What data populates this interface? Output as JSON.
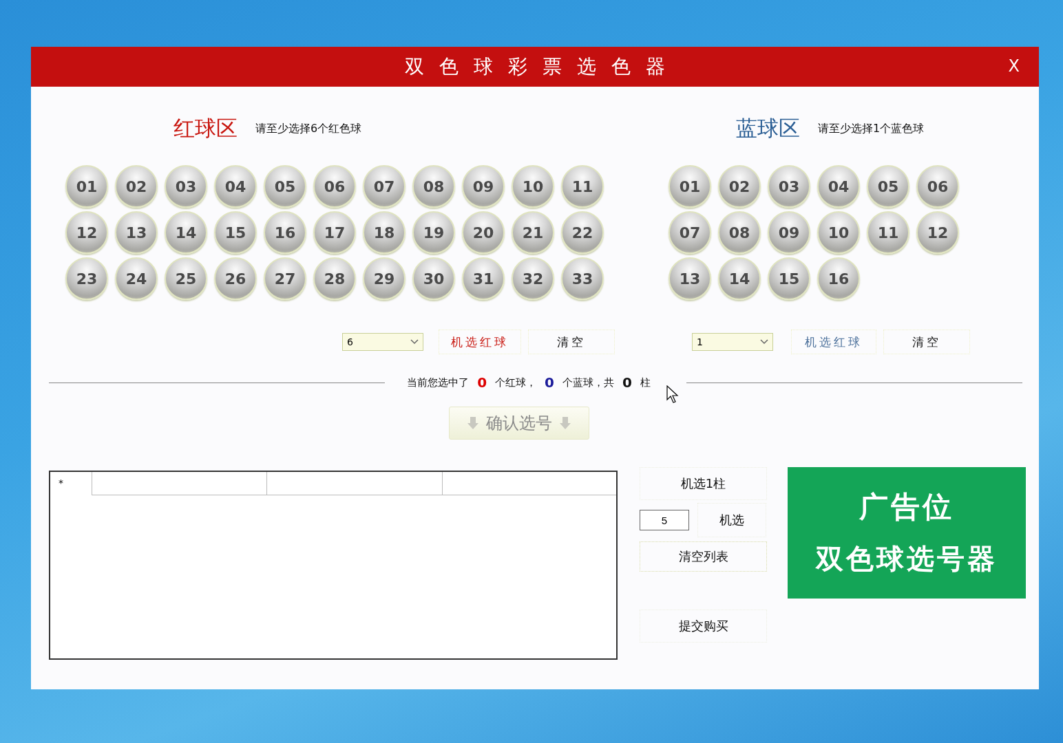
{
  "window": {
    "title": "双色球彩票选色器",
    "close": "X"
  },
  "red_zone": {
    "title": "红球区",
    "hint": "请至少选择6个红色球",
    "balls": [
      {
        "number": "01",
        "selected": false
      },
      {
        "number": "02",
        "selected": false
      },
      {
        "number": "03",
        "selected": false
      },
      {
        "number": "04",
        "selected": false
      },
      {
        "number": "05",
        "selected": false
      },
      {
        "number": "06",
        "selected": false
      },
      {
        "number": "07",
        "selected": false
      },
      {
        "number": "08",
        "selected": false
      },
      {
        "number": "09",
        "selected": false
      },
      {
        "number": "10",
        "selected": false
      },
      {
        "number": "11",
        "selected": false
      },
      {
        "number": "12",
        "selected": false
      },
      {
        "number": "13",
        "selected": false
      },
      {
        "number": "14",
        "selected": false
      },
      {
        "number": "15",
        "selected": false
      },
      {
        "number": "16",
        "selected": false
      },
      {
        "number": "17",
        "selected": false
      },
      {
        "number": "18",
        "selected": false
      },
      {
        "number": "19",
        "selected": false
      },
      {
        "number": "20",
        "selected": false
      },
      {
        "number": "21",
        "selected": false
      },
      {
        "number": "22",
        "selected": false
      },
      {
        "number": "23",
        "selected": false
      },
      {
        "number": "24",
        "selected": false
      },
      {
        "number": "25",
        "selected": false
      },
      {
        "number": "26",
        "selected": false
      },
      {
        "number": "27",
        "selected": false
      },
      {
        "number": "28",
        "selected": false
      },
      {
        "number": "29",
        "selected": false
      },
      {
        "number": "30",
        "selected": false
      },
      {
        "number": "31",
        "selected": false
      },
      {
        "number": "32",
        "selected": false
      },
      {
        "number": "33",
        "selected": false
      }
    ],
    "count_select": "6",
    "random_button": "机选红球",
    "clear_button": "清空"
  },
  "blue_zone": {
    "title": "蓝球区",
    "hint": "请至少选择1个蓝色球",
    "balls": [
      {
        "number": "01",
        "selected": false
      },
      {
        "number": "02",
        "selected": false
      },
      {
        "number": "03",
        "selected": false
      },
      {
        "number": "04",
        "selected": false
      },
      {
        "number": "05",
        "selected": false
      },
      {
        "number": "06",
        "selected": false
      },
      {
        "number": "07",
        "selected": false
      },
      {
        "number": "08",
        "selected": false
      },
      {
        "number": "09",
        "selected": false
      },
      {
        "number": "10",
        "selected": false
      },
      {
        "number": "11",
        "selected": false
      },
      {
        "number": "12",
        "selected": false
      },
      {
        "number": "13",
        "selected": false
      },
      {
        "number": "14",
        "selected": false
      },
      {
        "number": "15",
        "selected": false
      },
      {
        "number": "16",
        "selected": false
      }
    ],
    "count_select": "1",
    "random_button": "机选红球",
    "clear_button": "清空"
  },
  "summary": {
    "prefix": "当前您选中了",
    "red_count": "0",
    "red_suffix": "个红球，",
    "blue_count": "0",
    "blue_suffix": "个蓝球，共",
    "total": "0",
    "total_suffix": "柱"
  },
  "confirm_button": "确认选号",
  "selection_table": {
    "row_marker": "*"
  },
  "side_actions": {
    "random_one": "机选1柱",
    "count_field": "5",
    "random_n": "机选",
    "clear_list": "清空列表",
    "submit": "提交购买"
  },
  "ad": {
    "title": "广告位",
    "subtitle": "双色球选号器"
  }
}
